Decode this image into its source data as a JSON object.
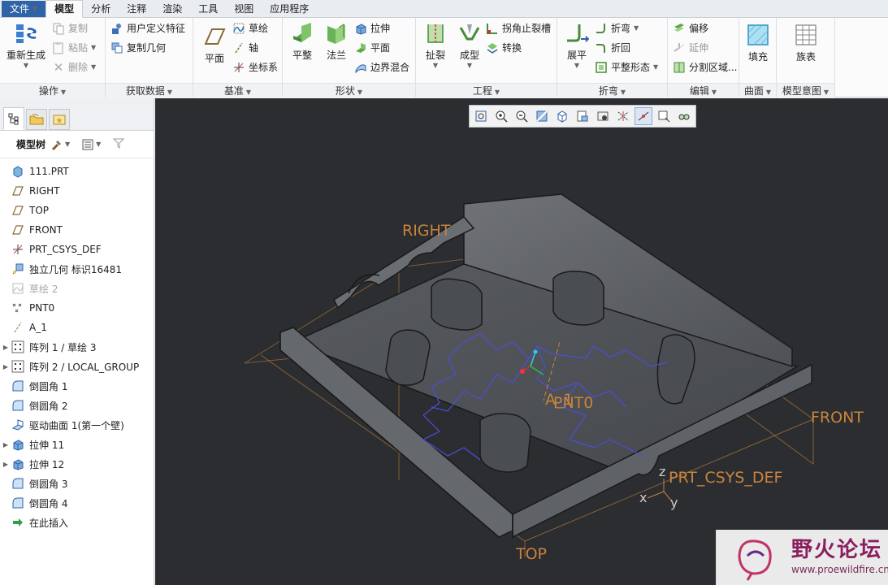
{
  "tabs": [
    {
      "label": "文件",
      "has_arrow": true
    },
    {
      "label": "模型",
      "active": true
    },
    {
      "label": "分析"
    },
    {
      "label": "注释"
    },
    {
      "label": "渲染"
    },
    {
      "label": "工具"
    },
    {
      "label": "视图"
    },
    {
      "label": "应用程序"
    }
  ],
  "ribbon": {
    "operations": {
      "label": "操作",
      "regenerate": "重新生成",
      "copy": "复制",
      "paste": "粘贴",
      "delete": "删除"
    },
    "get_data": {
      "label": "获取数据",
      "udf": "用户定义特征",
      "copy_geom": "复制几何"
    },
    "datum": {
      "label": "基准",
      "plane": "平面",
      "sketch": "草绘",
      "axis": "轴",
      "csys": "坐标系"
    },
    "shapes": {
      "label": "形状",
      "flatten": "平整",
      "flange": "法兰",
      "extrude": "拉伸",
      "planar": "平面",
      "blend": "边界混合"
    },
    "engineering": {
      "label": "工程",
      "rip": "扯裂",
      "form": "成型",
      "corner_relief": "拐角止裂槽",
      "convert": "转换"
    },
    "bends": {
      "label": "折弯",
      "unbend": "展平",
      "bend": "折弯",
      "bend_back": "折回",
      "flat_state": "平整形态"
    },
    "editing": {
      "label": "编辑",
      "offset": "偏移",
      "extend": "延伸",
      "split": "分割区域..."
    },
    "surfaces": {
      "label": "曲面",
      "fill": "填充"
    },
    "intent": {
      "label": "模型意图",
      "family": "族表"
    }
  },
  "panel": {
    "tree_label": "模型树",
    "items": [
      {
        "label": "111.PRT",
        "icon": "part-icon",
        "expand": false
      },
      {
        "label": "RIGHT",
        "icon": "datum-plane-icon",
        "expand": false
      },
      {
        "label": "TOP",
        "icon": "datum-plane-icon",
        "expand": false
      },
      {
        "label": "FRONT",
        "icon": "datum-plane-icon",
        "expand": false
      },
      {
        "label": "PRT_CSYS_DEF",
        "icon": "csys-icon",
        "expand": false
      },
      {
        "label": "独立几何 标识16481",
        "icon": "independent-geometry-icon",
        "expand": false
      },
      {
        "label": "草绘 2",
        "icon": "sketch-icon",
        "expand": false,
        "dim": true
      },
      {
        "label": "PNT0",
        "icon": "datum-point-icon",
        "expand": false
      },
      {
        "label": "A_1",
        "icon": "axis-icon",
        "expand": false
      },
      {
        "label": "阵列 1 / 草绘 3",
        "icon": "pattern-icon",
        "expand": true
      },
      {
        "label": "阵列 2 / LOCAL_GROUP",
        "icon": "pattern-icon",
        "expand": true
      },
      {
        "label": "倒圆角 1",
        "icon": "round-icon",
        "expand": false
      },
      {
        "label": "倒圆角 2",
        "icon": "round-icon",
        "expand": false
      },
      {
        "label": "驱动曲面 1(第一个壁)",
        "icon": "driving-surface-icon",
        "expand": false
      },
      {
        "label": "拉伸 11",
        "icon": "extrude-icon",
        "expand": true
      },
      {
        "label": "拉伸 12",
        "icon": "extrude-icon",
        "expand": true
      },
      {
        "label": "倒圆角 3",
        "icon": "round-icon",
        "expand": false
      },
      {
        "label": "倒圆角 4",
        "icon": "round-icon",
        "expand": false
      },
      {
        "label": "在此插入",
        "icon": "insert-here-icon",
        "expand": false
      }
    ]
  },
  "viewport": {
    "labels": {
      "right": "RIGHT",
      "front": "FRONT",
      "top": "TOP",
      "a1": "A_1",
      "pnt0": "PNT0",
      "csys": "PRT_CSYS_DEF",
      "x": "x",
      "y": "y",
      "z": "z"
    },
    "watermark_title": "野火论坛",
    "watermark_url": "www.proewildfire.cn"
  },
  "colors": {
    "file_tab": "#2f63a8",
    "viewport_bg": "#2b2d30",
    "datum_label": "#c8843c",
    "model_edge": "#1a1a1a",
    "sketch_lines": "#4a4fd8"
  }
}
